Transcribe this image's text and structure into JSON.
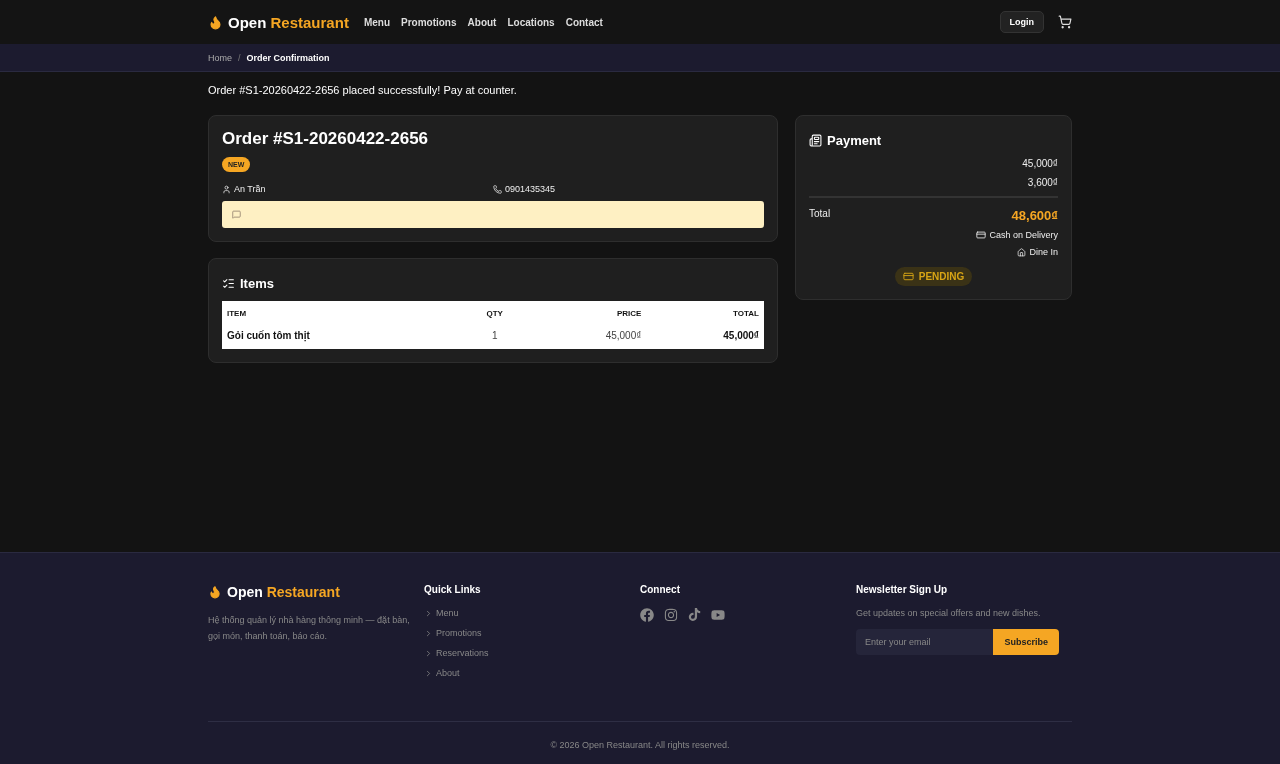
{
  "header": {
    "brand": {
      "first": "Open",
      "second": "Restaurant"
    },
    "nav": [
      {
        "label": "Menu"
      },
      {
        "label": "Promotions"
      },
      {
        "label": "About"
      },
      {
        "label": "Locations"
      },
      {
        "label": "Contact"
      }
    ],
    "login": "Login"
  },
  "breadcrumb": [
    {
      "label": "Home",
      "selected": false
    },
    {
      "label": "/",
      "kind": "separator"
    },
    {
      "label": "Order Confirmation",
      "selected": true
    }
  ],
  "message": "Order #S1-20260422-2656 placed successfully! Pay at counter.",
  "order": {
    "title": "Order #S1-20260422-2656",
    "status": "NEW",
    "customer": "An Trần",
    "phone": "0901435345"
  },
  "items": {
    "title": "Items",
    "table": {
      "columns": [
        "ITEM",
        "QTY",
        "PRICE",
        "TOTAL"
      ],
      "rows": [
        [
          "Gỏi cuốn tôm thịt",
          "1",
          "45,000₫",
          "45,000₫"
        ]
      ]
    }
  },
  "payment": {
    "title": "Payment",
    "lines": [
      "45,000₫",
      "3,600₫"
    ],
    "total_label": "Total",
    "total": "48,600₫",
    "method": "Cash on Delivery",
    "service": "Dine In",
    "status": "PENDING"
  },
  "footer": {
    "brand": {
      "first": "Open",
      "second": "Restaurant"
    },
    "description": "Hệ thống quản lý nhà hàng thông minh — đặt bàn, gọi món, thanh toán, báo cáo.",
    "quick_links": {
      "title": "Quick Links",
      "links": [
        "Menu",
        "Promotions",
        "Reservations",
        "About"
      ]
    },
    "connect": {
      "title": "Connect",
      "socials": [
        {
          "kind": "facebook"
        },
        {
          "kind": "instagram"
        },
        {
          "kind": "tiktok"
        },
        {
          "kind": "youtube"
        }
      ]
    },
    "newsletter": {
      "title": "Newsletter Sign Up",
      "text": "Get updates on special offers and new dishes.",
      "placeholder": "Enter your email",
      "button": "Subscribe"
    },
    "copyright": "© 2026 Open Restaurant. All rights reserved."
  }
}
